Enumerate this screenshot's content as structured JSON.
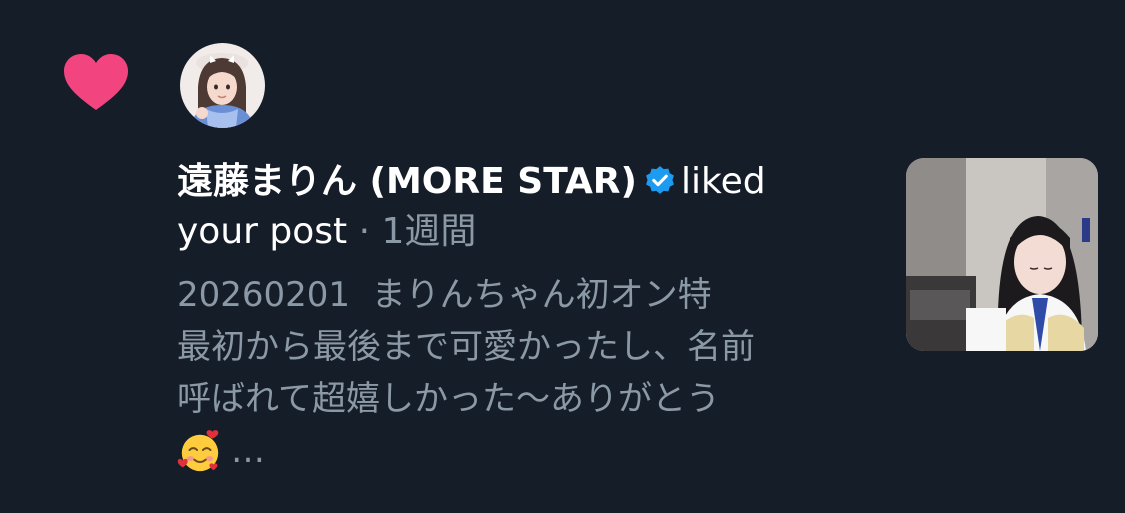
{
  "notification": {
    "type_icon": "heart-icon",
    "type_color": "#f2457f",
    "user": {
      "display_name": "遠藤まりん (MORE STAR)",
      "verified_icon": "verified-badge-icon",
      "verified_color": "#1d9bf0"
    },
    "action_text": "liked",
    "action_object": "your post",
    "separator": "·",
    "timestamp": "1週間",
    "post_lines": [
      "20260201  まりんちゃん初オン特",
      "最初から最後まで可愛かったし、名前",
      "呼ばれて超嬉しかった〜ありがとう"
    ],
    "post_emoji": "smiling-face-with-hearts-icon",
    "post_ellipsis": "…"
  }
}
